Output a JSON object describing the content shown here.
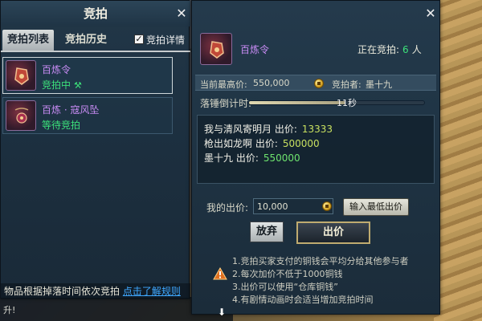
{
  "left_panel": {
    "title": "竞拍",
    "tabs": [
      {
        "label": "竞拍列表",
        "active": true
      },
      {
        "label": "竞拍历史",
        "active": false
      }
    ],
    "detail_toggle": {
      "label": "竞拍详情",
      "checked": true,
      "check_glyph": "✓"
    },
    "lots": [
      {
        "name": "百炼令",
        "status": "竞拍中",
        "status_icon": "hammer-icon",
        "selected": true
      },
      {
        "name": "百炼 · 寇风坠",
        "status": "等待竞拍",
        "selected": false
      }
    ],
    "footer": {
      "text": "物品根据掉落时间依次竞拍",
      "link": "点击了解规则"
    }
  },
  "right_panel": {
    "item_name": "百炼令",
    "bidding_label": "正在竞拍:",
    "bidding_count": "6",
    "bidding_unit": "人",
    "current_high_label": "当前最高价:",
    "current_high_value": "550,000",
    "bidder_label": "竞拍者:",
    "bidder_name": "墨十九",
    "countdown_label": "落锤倒计时:",
    "countdown_value": "11秒",
    "countdown_fraction": 0.55,
    "bid_log": [
      {
        "text": "我与清风寄明月 出价:",
        "amount": "13333",
        "color": "yellow"
      },
      {
        "text": "枪出如龙啊 出价:",
        "amount": "500000",
        "color": "yellow"
      },
      {
        "text": "墨十九 出价:",
        "amount": "550000",
        "color": "green"
      }
    ],
    "my_bid_label": "我的出价:",
    "my_bid_value": "10,000",
    "min_bid_button": "输入最低出价",
    "abandon_button": "放弃",
    "bid_button": "出价",
    "rules": [
      "1.竞拍买家支付的铜钱会平均分给其他参与者",
      "2.每次加价不低于1000铜钱",
      "3.出价可以使用“仓库铜钱”",
      "4.有剧情动画时会适当增加竞拍时间"
    ]
  },
  "chat": {
    "line": "升!"
  },
  "colors": {
    "panel_bg": "#1e3242",
    "item_purple": "#c98cf5",
    "status_green": "#3ce07a",
    "link_blue": "#3fa8ff",
    "bid_button_border": "#c0ac70"
  }
}
